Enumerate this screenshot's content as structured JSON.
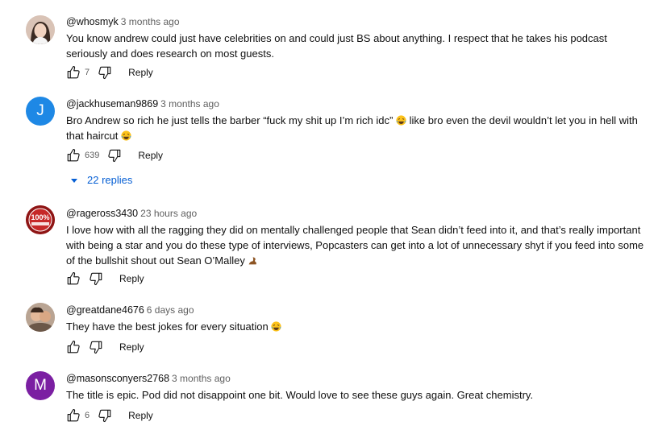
{
  "comments": [
    {
      "author": "@whosmyk",
      "time": "3 months ago",
      "text": "You know andrew could just have celebrities on and could just BS about anything. I respect that he takes his podcast seriously and does research on most guests.",
      "likes": "7",
      "reply_label": "Reply",
      "avatar_icon": "photo-avatar"
    },
    {
      "author": "@jackhuseman9869",
      "time": "3 months ago",
      "text": "Bro Andrew so rich he just tells the barber “fuck my shit up I’m rich idc”",
      "text_2": "like bro even the devil wouldn’t let you in hell with that haircut",
      "likes": "639",
      "reply_label": "Reply",
      "avatar_letter": "J",
      "avatar_color": "#1e88e5"
    },
    {
      "author": "@rageross3430",
      "time": "23 hours ago",
      "text": "I love how with all the ragging they did on mentally challenged people that Sean didn’t feed into it, and that’s really important with being a star and you do these type of interviews, Popcasters can get into a lot of unnecessary shyt if you feed into some of the bullshit shout out Sean O’Malley",
      "reply_label": "Reply",
      "avatar_text": "100%",
      "avatar_color": "#b71c1c"
    },
    {
      "author": "@greatdane4676",
      "time": "6 days ago",
      "text": "They have the best jokes for every situation",
      "reply_label": "Reply",
      "avatar_icon": "photo-avatar"
    },
    {
      "author": "@masonsconyers2768",
      "time": "3 months ago",
      "text": "The title is epic. Pod did not disappoint one bit. Would love to see these guys again. Great chemistry.",
      "likes": "6",
      "reply_label": "Reply",
      "avatar_letter": "M",
      "avatar_color": "#7b1fa2"
    }
  ],
  "replies_toggle": {
    "label": "22 replies",
    "color": "#065fd4"
  },
  "icons": {
    "like": "thumbs-up-icon",
    "dislike": "thumbs-down-icon",
    "expand": "caret-down-icon",
    "laugh": "laughing-emoji-icon",
    "flex": "flexed-biceps-emoji-icon"
  }
}
